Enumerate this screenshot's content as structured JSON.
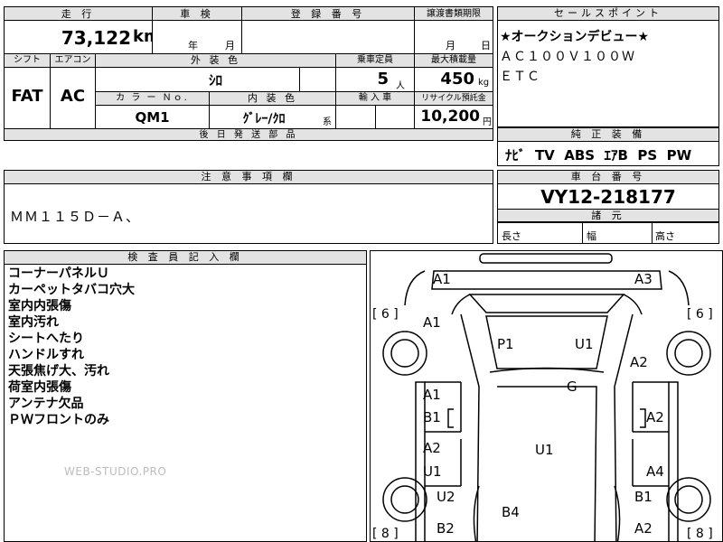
{
  "top": {
    "mileage_header": "走 行",
    "mileage_value": "73,122",
    "mileage_unit": "km",
    "inspection_header": "車 検",
    "inspection_year": "年",
    "inspection_month": "月",
    "reg_header": "登 録 番 号",
    "transfer_header": "譲渡書類期限",
    "transfer_month": "月",
    "transfer_day": "日"
  },
  "sales": {
    "header": "セールスポイント",
    "lines": [
      "★オークションデビュー★",
      "ＡＣ１００Ｖ１００Ｗ",
      "ＥＴＣ"
    ]
  },
  "spec": {
    "shift_header": "シフト",
    "aircon_header": "エアコン",
    "exterior_header": "外 装 色",
    "capacity_header": "乗車定員",
    "load_header": "最大積載量",
    "shift_value": "FAT",
    "aircon_value": "AC",
    "exterior_value": "ｼﾛ",
    "capacity_value": "5",
    "capacity_unit": "人",
    "load_value": "450",
    "load_unit": "kg",
    "color_no_header": "カ ラ ー Ｎｏ.",
    "interior_header": "内 装 色",
    "import_header": "輸 入 車",
    "recycle_header": "リサイクル預託金",
    "color_no_value": "QM1",
    "interior_value": "ｸﾞﾚｰ/ｸﾛ",
    "interior_suffix": "系",
    "recycle_value": "10,200",
    "recycle_unit": "円",
    "later_parts_header": "後 日 発 送 部 品"
  },
  "equipment": {
    "header": "純 正 装 備",
    "value": "ﾅﾋﾞ  TV  ABS  ｴｱB  PS  PW"
  },
  "notes": {
    "header": "注 意 事 項 欄",
    "value": "ＭＭ１１５Ｄ－Ａ、"
  },
  "chassis": {
    "header": "車 台 番 号",
    "value": "VY12-218177",
    "dims_header": "諸 元",
    "length_label": "長さ",
    "width_label": "幅",
    "height_label": "高さ"
  },
  "inspector": {
    "header": "検 査 員 記 入 欄",
    "lines": [
      "コーナーパネルＵ",
      "カーペットタバコ穴大",
      "室内内張傷",
      "室内汚れ",
      "シートへたり",
      "ハンドルすれ",
      "天張焦げ大、汚れ",
      "荷室内張傷",
      "アンテナ欠品",
      "ＰＷフロントのみ"
    ]
  },
  "watermark": "WEB-STUDIO.PRO",
  "diagram": {
    "marks": [
      {
        "id": "front-left-corner",
        "text": "A1"
      },
      {
        "id": "front-right-corner",
        "text": "A3"
      },
      {
        "id": "left-front-fender",
        "text": "A1"
      },
      {
        "id": "windshield",
        "text": "P1"
      },
      {
        "id": "roof-front",
        "text": "U1"
      },
      {
        "id": "right-front-fender",
        "text": "A2"
      },
      {
        "id": "glass",
        "text": "G"
      },
      {
        "id": "left-front-door-a",
        "text": "A1"
      },
      {
        "id": "left-front-door-b",
        "text": "B1"
      },
      {
        "id": "right-front-door",
        "text": "A2"
      },
      {
        "id": "roof-center",
        "text": "U1"
      },
      {
        "id": "left-rear-door-a",
        "text": "A2"
      },
      {
        "id": "left-rear-door-u",
        "text": "U1"
      },
      {
        "id": "right-rear-door",
        "text": "A4"
      },
      {
        "id": "left-rear-fender",
        "text": "U2"
      },
      {
        "id": "right-rear-fender",
        "text": "B1"
      },
      {
        "id": "rear-center",
        "text": "B4"
      },
      {
        "id": "left-rear-corner",
        "text": "B2"
      },
      {
        "id": "right-rear-corner",
        "text": "A2"
      }
    ],
    "tires": [
      {
        "id": "tire-front-left",
        "text": "[ 6 ]"
      },
      {
        "id": "tire-front-right",
        "text": "[ 6 ]"
      },
      {
        "id": "tire-rear-left",
        "text": "[ 8 ]"
      },
      {
        "id": "tire-rear-right",
        "text": "[ 8 ]"
      }
    ]
  }
}
